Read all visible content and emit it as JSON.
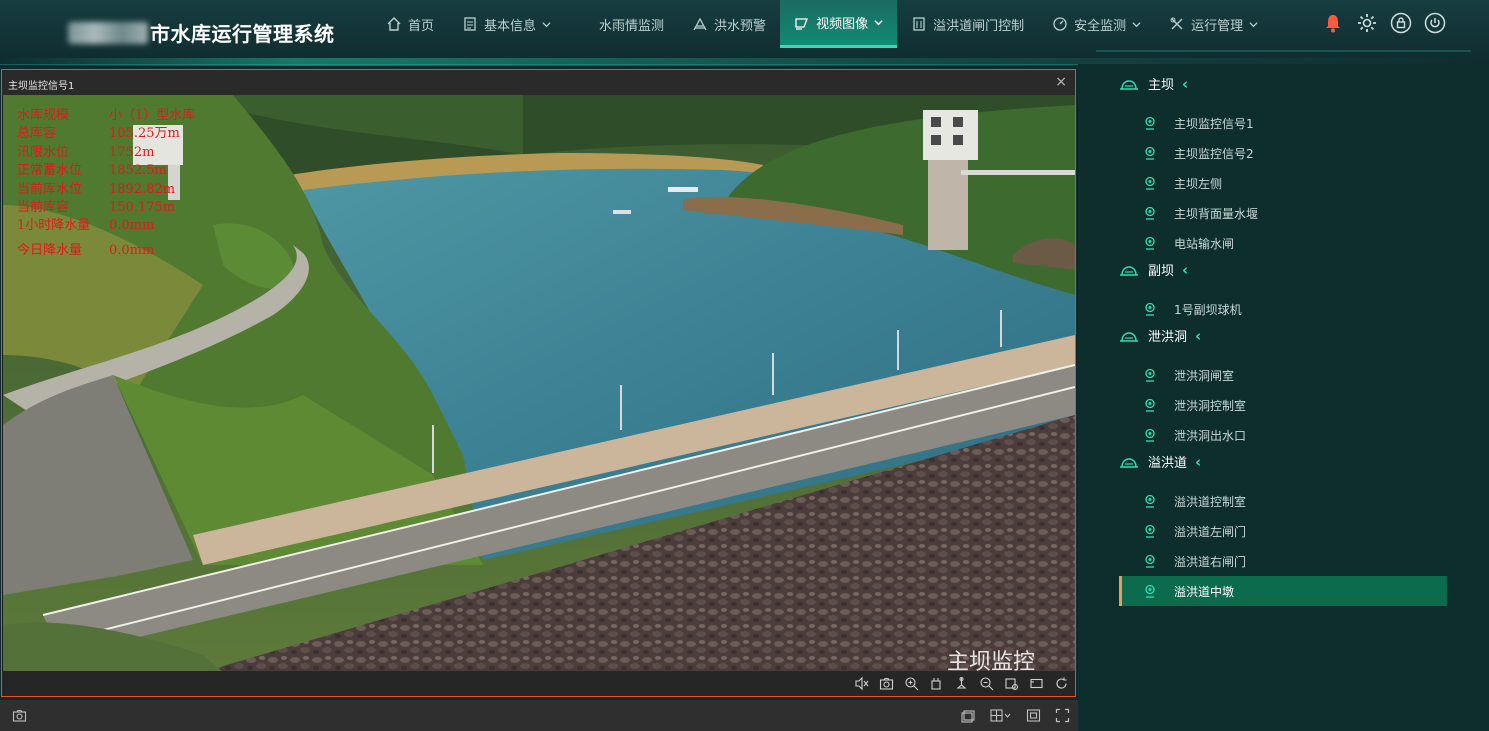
{
  "header": {
    "app_title": "市水库运行管理系统",
    "nav": [
      {
        "label": "首页",
        "icon": "home-icon",
        "dropdown": false
      },
      {
        "label": "基本信息",
        "icon": "document-icon",
        "dropdown": true
      },
      {
        "label": "水雨情监测",
        "icon": "",
        "dropdown": false
      },
      {
        "label": "洪水预警",
        "icon": "flood-icon",
        "dropdown": false
      },
      {
        "label": "视频图像",
        "icon": "video-icon",
        "dropdown": true,
        "active": true
      },
      {
        "label": "溢洪道闸门控制",
        "icon": "building-icon",
        "dropdown": false
      },
      {
        "label": "安全监测",
        "icon": "gauge-icon",
        "dropdown": true
      },
      {
        "label": "运行管理",
        "icon": "tools-icon",
        "dropdown": true
      }
    ],
    "icons": [
      "bell-icon",
      "settings-icon",
      "lock-icon",
      "power-icon"
    ]
  },
  "video": {
    "title": "主坝监控信号1",
    "close": "×",
    "osd": [
      {
        "label": "水库规模",
        "value": "小（1）型水库"
      },
      {
        "label": "总库容",
        "value": "105.25万m"
      },
      {
        "label": "汛限水位",
        "value": "1752m"
      },
      {
        "label": "正常蓄水位",
        "value": "1852.5m"
      },
      {
        "label": "当前库水位",
        "value": "1892.82m"
      },
      {
        "label": "当前库容",
        "value": "150.175m"
      },
      {
        "label": "1小时降水量",
        "value": "0.0mm"
      },
      {
        "label": "今日降水量",
        "value": "0.0mm"
      }
    ],
    "watermark": "主坝监控",
    "controls": [
      "mute-icon",
      "snapshot-icon",
      "zoom-in-icon",
      "crop-icon",
      "ptz-icon",
      "zoom-icon",
      "settings-icon",
      "fullscreen-window-icon",
      "refresh-icon"
    ]
  },
  "bottom_bar": {
    "left_icon": "camera-icon",
    "right_icons": [
      "window-icon",
      "layout-grid-icon",
      "expand-icon",
      "fullscreen-icon"
    ]
  },
  "sidebar": {
    "groups": [
      {
        "label": "主坝",
        "items": [
          "主坝监控信号1",
          "主坝监控信号2",
          "主坝左侧",
          "主坝背面量水堰",
          "电站输水闸"
        ]
      },
      {
        "label": "副坝",
        "items": [
          "1号副坝球机"
        ]
      },
      {
        "label": "泄洪洞",
        "items": [
          "泄洪洞闸室",
          "泄洪洞控制室",
          "泄洪洞出水口"
        ]
      },
      {
        "label": "溢洪道",
        "items": [
          "溢洪道控制室",
          "溢洪道左闸门",
          "溢洪道右闸门",
          "溢洪道中墩"
        ]
      }
    ],
    "selected": "溢洪道中墩"
  },
  "colors": {
    "accent": "#2de0b4",
    "active_nav": "#128a74",
    "selected_item": "#0c6b4d",
    "panel_border": "#e2541c",
    "bell": "#ff5a3c",
    "osd_text": "#e01a1a"
  }
}
